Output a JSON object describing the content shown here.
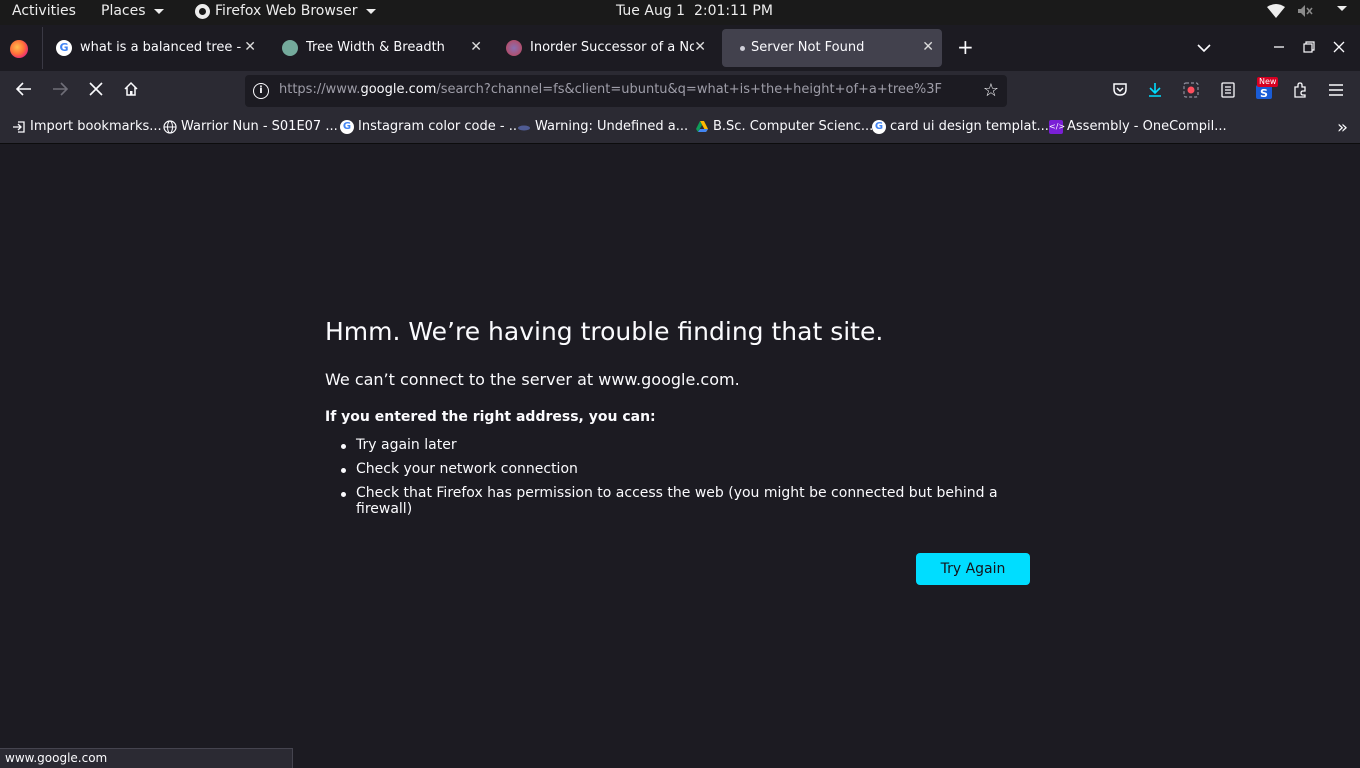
{
  "system_bar": {
    "activities": "Activities",
    "places": "Places",
    "app_name": "Firefox Web Browser",
    "clock": "Tue Aug 1  2:01:11 PM"
  },
  "tabs": [
    {
      "title": "what is a balanced tree - Google Search",
      "favicon": "google-icon"
    },
    {
      "title": "Tree Width & Breadth",
      "favicon": "chatgpt-icon"
    },
    {
      "title": "Inorder Successor of a Node in Binary Tree",
      "favicon": "gfg-icon"
    },
    {
      "title": "Server Not Found",
      "favicon": "loading-dot",
      "active": true
    }
  ],
  "navbar": {
    "url_prefix": "https://www.",
    "url_host": "google.com",
    "url_rest": "/search?channel=fs&client=ubuntu&q=what+is+the+height+of+a+tree%3F",
    "badge": "New"
  },
  "bookmarks": [
    {
      "label": "Import bookmarks...",
      "icon": "import-icon"
    },
    {
      "label": "Warrior Nun - S01E07 ...",
      "icon": "globe-icon"
    },
    {
      "label": "Instagram color code - ...",
      "icon": "google-icon"
    },
    {
      "label": "Warning: Undefined a...",
      "icon": "php-icon"
    },
    {
      "label": "B.Sc. Computer Scienc...",
      "icon": "drive-icon"
    },
    {
      "label": "card ui design templat...",
      "icon": "google-icon"
    },
    {
      "label": "Assembly - OneCompil...",
      "icon": "onecompiler-icon"
    }
  ],
  "error": {
    "title": "Hmm. We’re having trouble finding that site.",
    "lead": "We can’t connect to the server at www.google.com.",
    "hint": "If you entered the right address, you can:",
    "suggestions": [
      "Try again later",
      "Check your network connection",
      "Check that Firefox has permission to access the web (you might be connected but behind a firewall)"
    ],
    "button": "Try Again"
  },
  "status": "www.google.com",
  "colors": {
    "accent": "#00ddff",
    "background": "#1c1b22",
    "toolbar": "#2b2a33"
  }
}
